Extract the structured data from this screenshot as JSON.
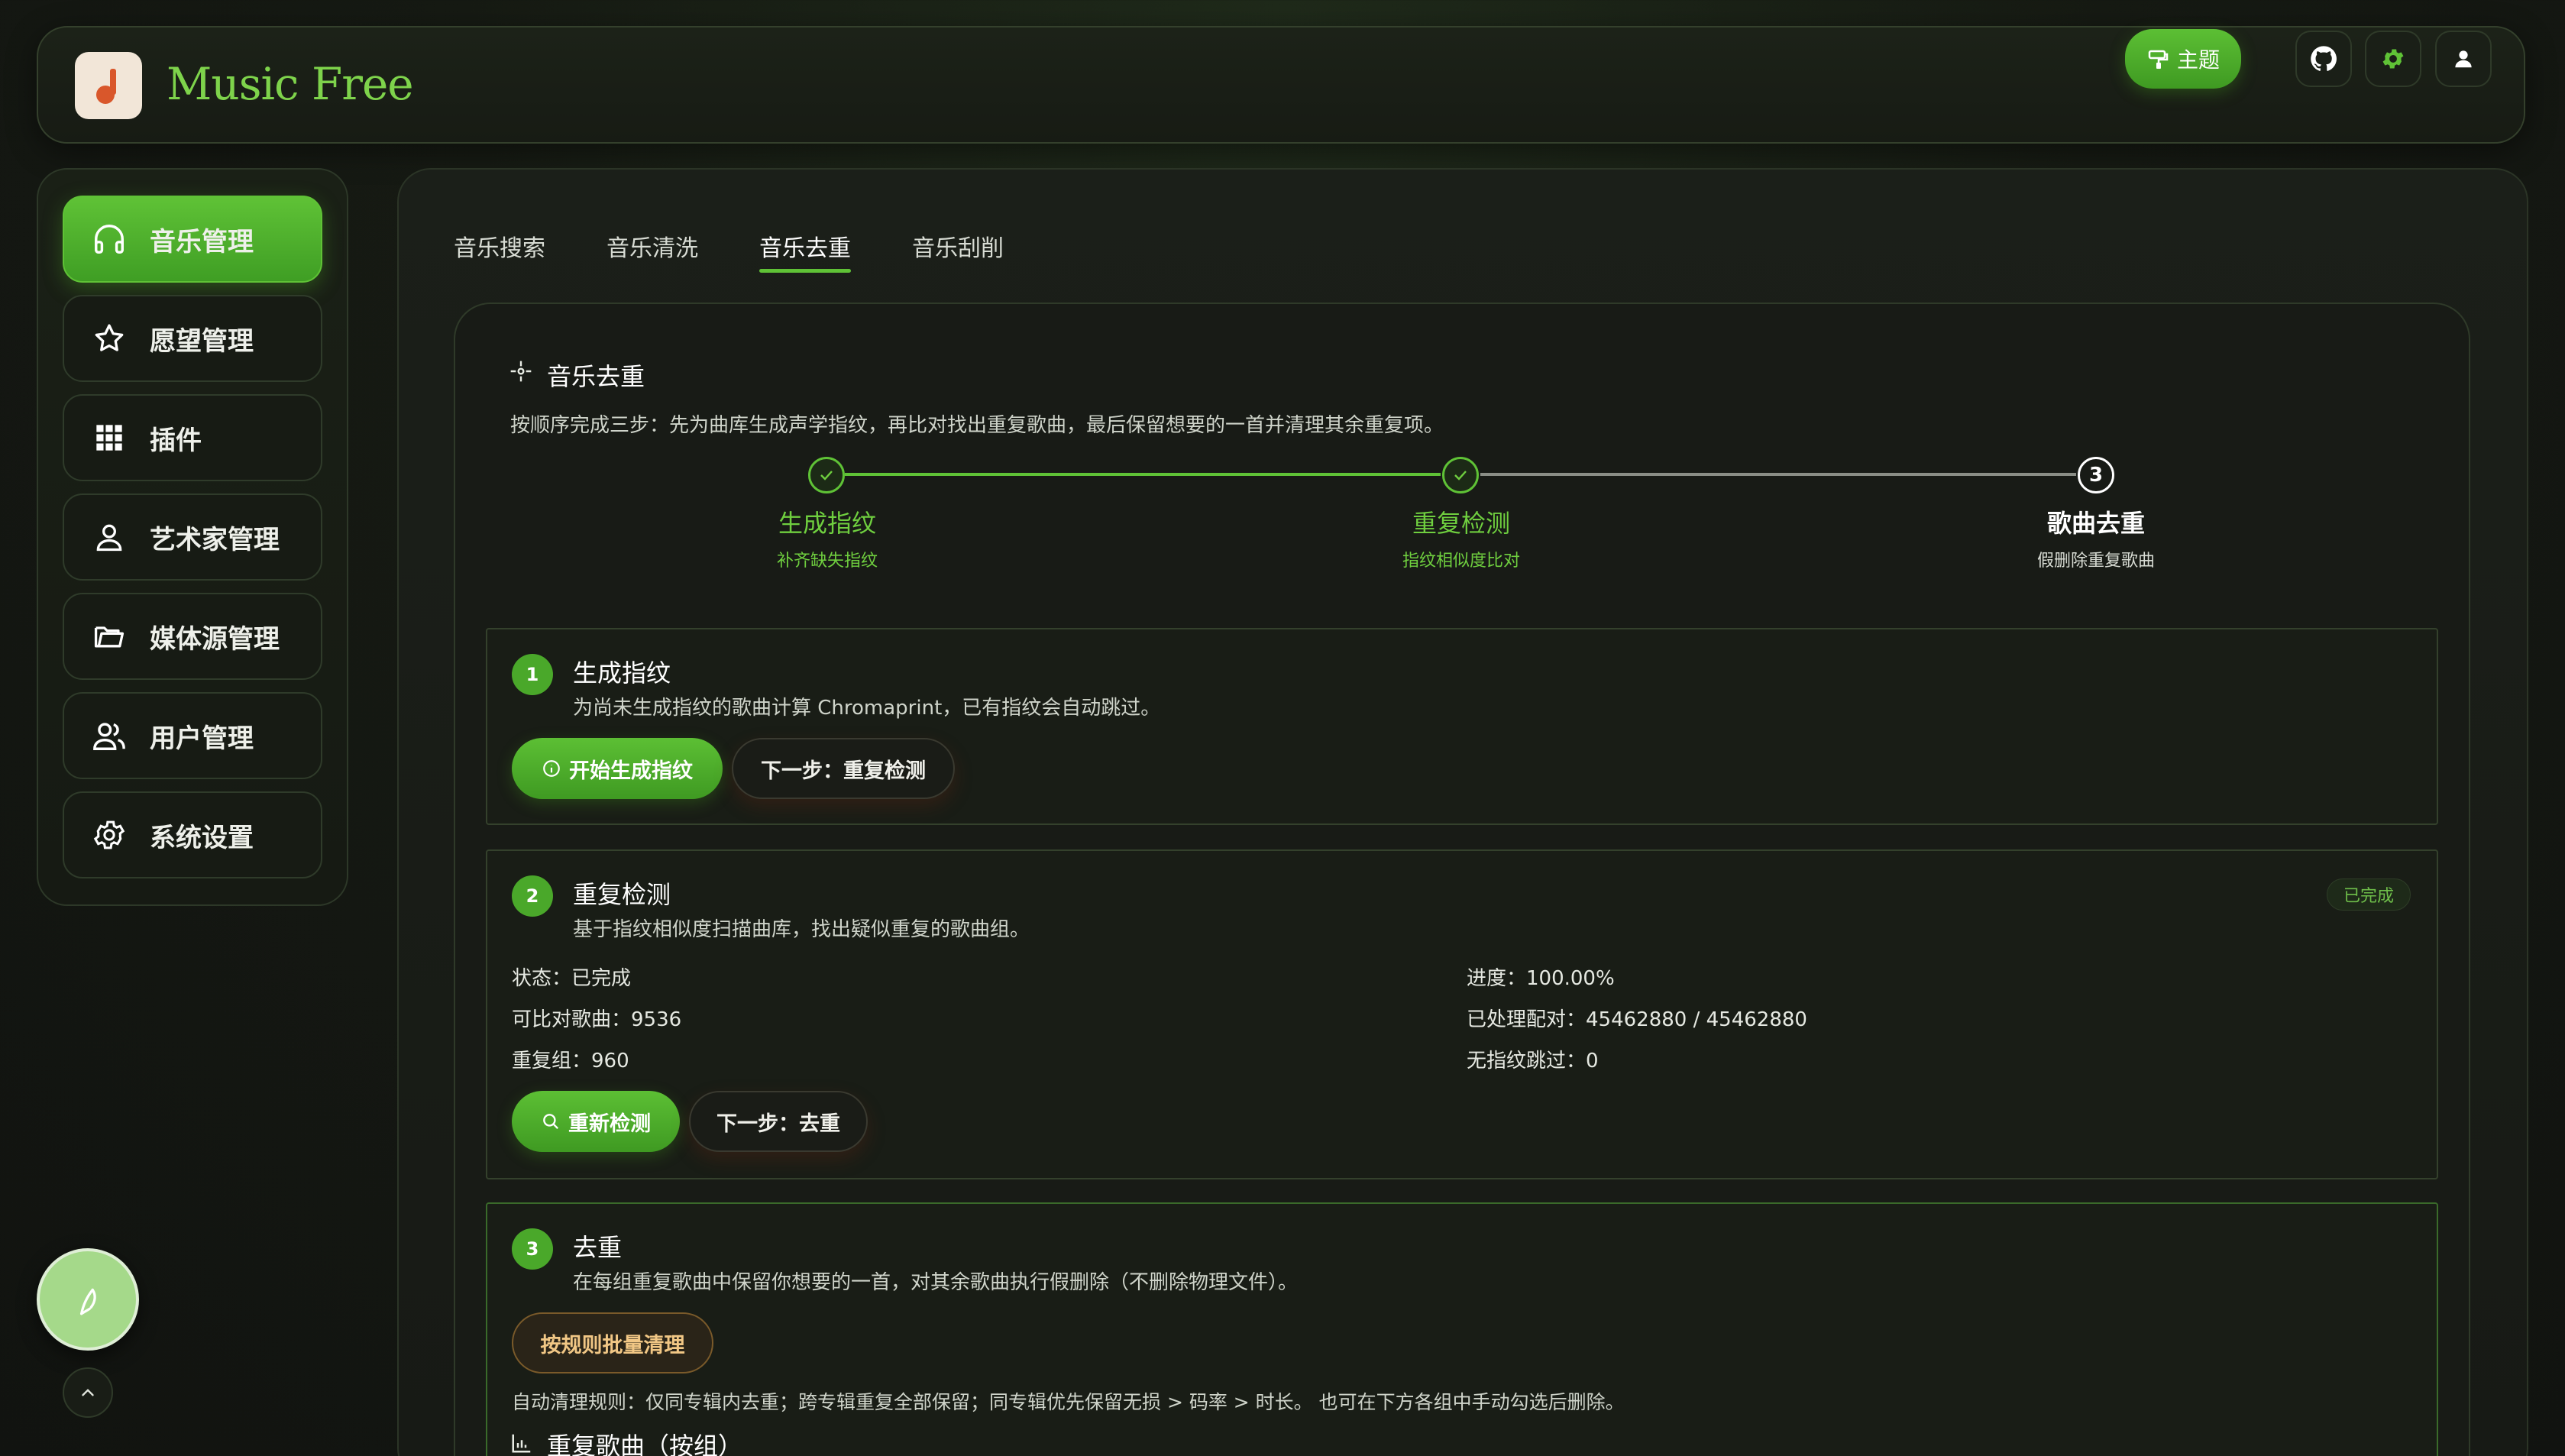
{
  "app": {
    "title": "Music Free"
  },
  "header": {
    "theme_label": "主题"
  },
  "sidebar": {
    "items": [
      {
        "label": "音乐管理",
        "icon": "headphones-icon",
        "active": true
      },
      {
        "label": "愿望管理",
        "icon": "star-icon"
      },
      {
        "label": "插件",
        "icon": "grid-icon"
      },
      {
        "label": "艺术家管理",
        "icon": "user-icon"
      },
      {
        "label": "媒体源管理",
        "icon": "folder-icon"
      },
      {
        "label": "用户管理",
        "icon": "users-icon"
      },
      {
        "label": "系统设置",
        "icon": "gear-icon"
      }
    ]
  },
  "tabs": [
    {
      "label": "音乐搜索"
    },
    {
      "label": "音乐清洗"
    },
    {
      "label": "音乐去重",
      "active": true
    },
    {
      "label": "音乐刮削"
    }
  ],
  "dedup": {
    "title": "音乐去重",
    "description": "按顺序完成三步：先为曲库生成声学指纹，再比对找出重复歌曲，最后保留想要的一首并清理其余重复项。",
    "steps": [
      {
        "label": "生成指纹",
        "sub": "补齐缺失指纹",
        "status": "done"
      },
      {
        "label": "重复检测",
        "sub": "指纹相似度比对",
        "status": "done"
      },
      {
        "label": "歌曲去重",
        "sub": "假删除重复歌曲",
        "status": "current",
        "number": "3"
      }
    ],
    "panel1": {
      "number": "1",
      "title": "生成指纹",
      "description": "为尚未生成指纹的歌曲计算 Chromaprint，已有指纹会自动跳过。",
      "primary_button": "开始生成指纹",
      "secondary_button": "下一步：重复检测"
    },
    "panel2": {
      "number": "2",
      "title": "重复检测",
      "description": "基于指纹相似度扫描曲库，找出疑似重复的歌曲组。",
      "badge": "已完成",
      "stats": {
        "status": "状态：已完成",
        "comparable": "可比对歌曲：9536",
        "groups": "重复组：960",
        "progress": "进度：100.00%",
        "processed": "已处理配对：45462880 / 45462880",
        "skipped": "无指纹跳过：0"
      },
      "primary_button": "重新检测",
      "secondary_button": "下一步：去重"
    },
    "panel3": {
      "number": "3",
      "title": "去重",
      "description": "在每组重复歌曲中保留你想要的一首，对其余歌曲执行假删除（不删除物理文件）。",
      "batch_button": "按规则批量清理",
      "rule_text": "自动清理规则：仅同专辑内去重；跨专辑重复全部保留；同专辑优先保留无损 > 码率 > 时长。 也可在下方各组中手动勾选后删除。",
      "groups_title": "重复歌曲（按组）"
    }
  },
  "colors": {
    "accent": "#5fc236",
    "background": "#161a13"
  }
}
